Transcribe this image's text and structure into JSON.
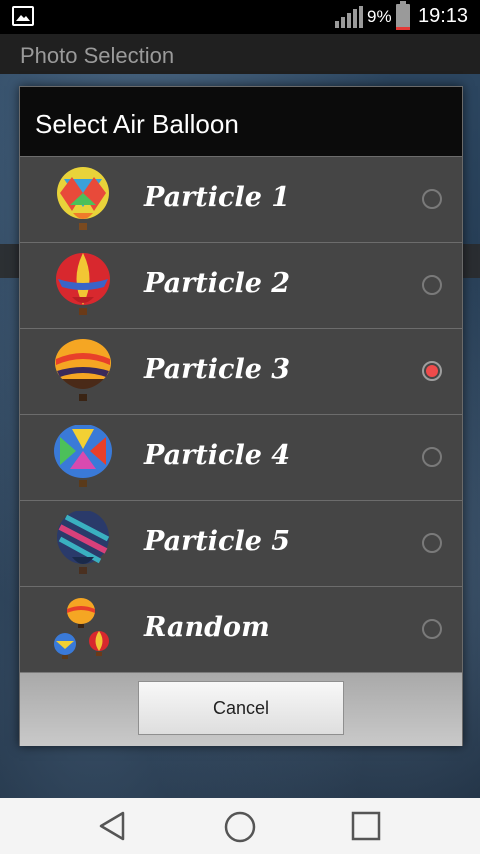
{
  "status_bar": {
    "battery_percent": "9%",
    "time": "19:13",
    "icons": [
      "gallery-icon",
      "signal-icon",
      "battery-icon"
    ]
  },
  "app": {
    "title": "Photo Selection"
  },
  "dialog": {
    "title": "Select Air Balloon",
    "items": [
      {
        "label": "Particle 1",
        "selected": false,
        "icon": "balloon-1-icon"
      },
      {
        "label": "Particle 2",
        "selected": false,
        "icon": "balloon-2-icon"
      },
      {
        "label": "Particle 3",
        "selected": true,
        "icon": "balloon-3-icon"
      },
      {
        "label": "Particle 4",
        "selected": false,
        "icon": "balloon-4-icon"
      },
      {
        "label": "Particle 5",
        "selected": false,
        "icon": "balloon-5-icon"
      },
      {
        "label": "Random",
        "selected": false,
        "icon": "balloon-random-icon"
      }
    ],
    "cancel_label": "Cancel",
    "accent_color": "#ef4b4b"
  },
  "nav_bar": {
    "icons": [
      "back-icon",
      "home-icon",
      "recents-icon"
    ]
  }
}
